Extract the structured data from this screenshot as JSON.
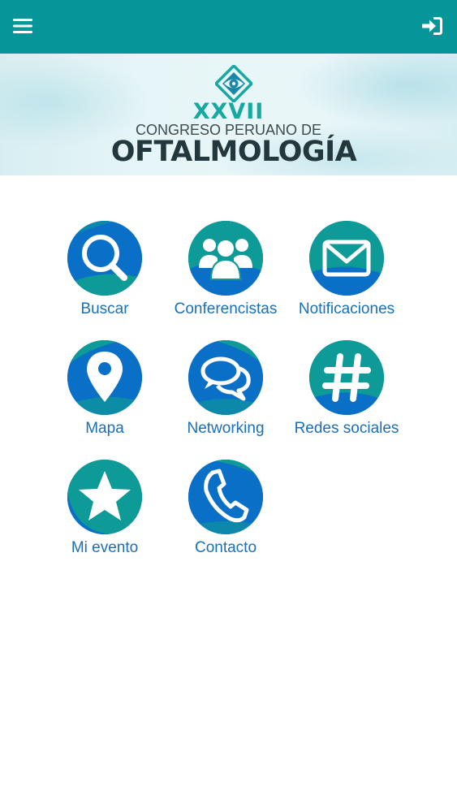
{
  "header": {
    "menu_icon": "hamburger-menu-icon",
    "login_icon": "sign-in-icon",
    "background_color": "#06969a"
  },
  "banner": {
    "edition": "XXVII",
    "subtitle": "CONGRESO PERUANO DE",
    "title": "OFTALMOLOGÍA",
    "logo_icon": "eye-diamond-logo-icon"
  },
  "menu": {
    "items": [
      {
        "label": "Buscar",
        "icon": "search-icon"
      },
      {
        "label": "Conferencistas",
        "icon": "users-group-icon"
      },
      {
        "label": "Notificaciones",
        "icon": "envelope-icon"
      },
      {
        "label": "Mapa",
        "icon": "map-pin-icon"
      },
      {
        "label": "Networking",
        "icon": "chat-bubbles-icon"
      },
      {
        "label": "Redes sociales",
        "icon": "hashtag-icon"
      },
      {
        "label": "Mi evento",
        "icon": "star-icon"
      },
      {
        "label": "Contacto",
        "icon": "phone-icon"
      }
    ]
  },
  "colors": {
    "circle_blue": "#0a6fc6",
    "circle_teal": "#0e9a97",
    "label_blue": "#1a6fb6"
  }
}
